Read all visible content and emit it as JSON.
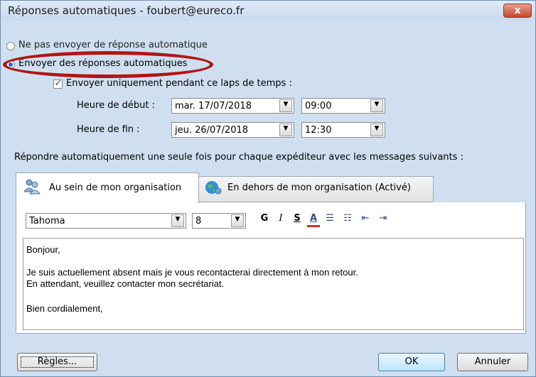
{
  "window": {
    "title": "Réponses automatiques - foubert@eureco.fr",
    "close_label": "x"
  },
  "mode": {
    "option_off": "Ne pas envoyer de réponse automatique",
    "option_on": "Envoyer des réponses automatiques",
    "selected": "option_on"
  },
  "time_range": {
    "checkbox_label": "Envoyer uniquement pendant ce laps de temps :",
    "checked": true,
    "start_label": "Heure de début :",
    "start_date": "mar. 17/07/2018",
    "start_time": "09:00",
    "end_label": "Heure de fin :",
    "end_date": "jeu. 26/07/2018",
    "end_time": "12:30"
  },
  "instructions": "Répondre automatiquement une seule fois pour chaque expéditeur avec les messages suivants :",
  "tabs": [
    {
      "label": "Au sein de mon organisation",
      "icon": "people-icon",
      "active": true
    },
    {
      "label": "En dehors de mon organisation (Activé)",
      "icon": "globe-people-icon",
      "active": false
    }
  ],
  "toolbar": {
    "font_name": "Tahoma",
    "font_size": "8",
    "bold": "G",
    "italic": "I",
    "underline": "S",
    "font_color": "A",
    "font_color_hex": "#d0301f"
  },
  "message": {
    "lines": [
      "Bonjour,",
      "",
      "Je suis actuellement absent mais je vous recontacterai directement à mon retour.",
      "En attendant, veuillez contacter mon secrétariat.",
      "",
      "Bien cordialement,"
    ]
  },
  "buttons": {
    "rules": "Règles...",
    "ok": "OK",
    "cancel": "Annuler"
  },
  "colors": {
    "highlight_ellipse": "#b01515",
    "radio_selected": "#1e66c9"
  }
}
